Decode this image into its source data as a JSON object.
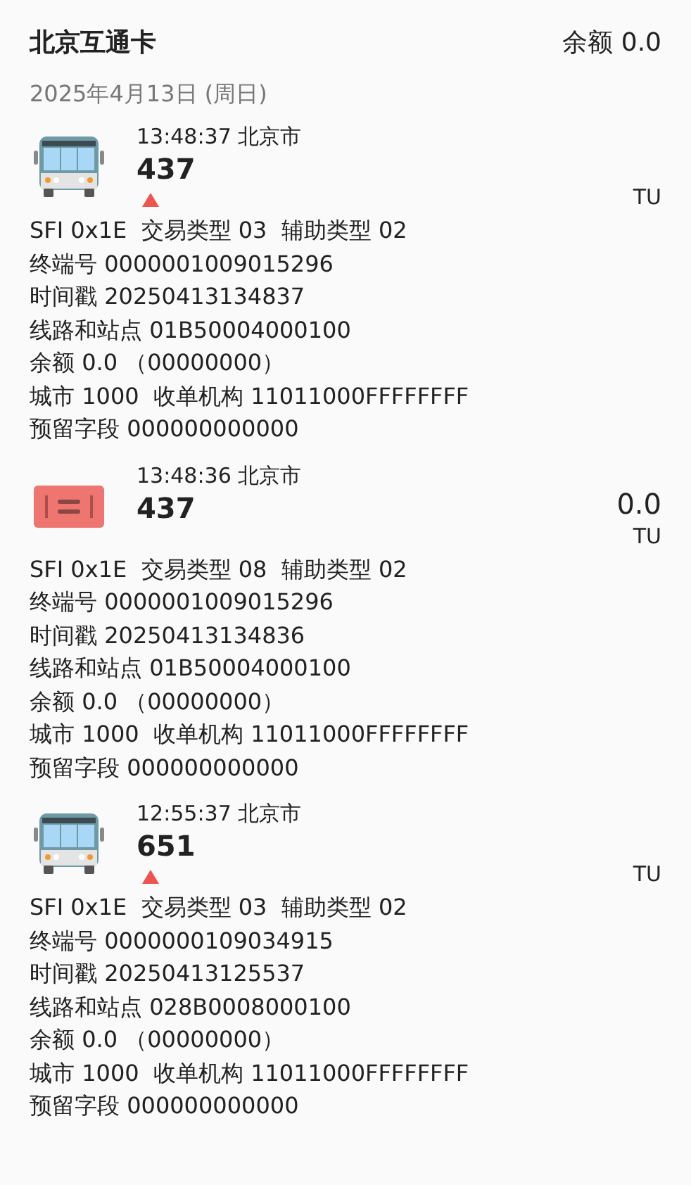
{
  "header": {
    "title": "北京互通卡",
    "balance": "余额 0.0"
  },
  "date": "2025年4月13日 (周日)",
  "records": [
    {
      "kind": "bus",
      "time": "13:48:37  北京市",
      "route": "437",
      "up_marker": true,
      "unit": "TU",
      "details": [
        "SFI 0x1E  交易类型 03  辅助类型 02",
        "终端号 0000001009015296",
        "时间戳 20250413134837",
        "线路和站点 01B50004000100",
        "余额 0.0 （00000000）",
        "城市 1000  收单机构 11011000FFFFFFFF",
        "预留字段 000000000000"
      ]
    },
    {
      "kind": "ticket",
      "time": "13:48:36  北京市",
      "route": "437",
      "up_marker": false,
      "amount": "0.0",
      "unit": "TU",
      "details": [
        "SFI 0x1E  交易类型 08  辅助类型 02",
        "终端号 0000001009015296",
        "时间戳 20250413134836",
        "线路和站点 01B50004000100",
        "余额 0.0 （00000000）",
        "城市 1000  收单机构 11011000FFFFFFFF",
        "预留字段 000000000000"
      ]
    },
    {
      "kind": "bus",
      "time": "12:55:37  北京市",
      "route": "651",
      "up_marker": true,
      "unit": "TU",
      "details": [
        "SFI 0x1E  交易类型 03  辅助类型 02",
        "终端号 0000000109034915",
        "时间戳 20250413125537",
        "线路和站点 028B0008000100",
        "余额 0.0 （00000000）",
        "城市 1000  收单机构 11011000FFFFFFFF",
        "预留字段 000000000000"
      ]
    }
  ]
}
